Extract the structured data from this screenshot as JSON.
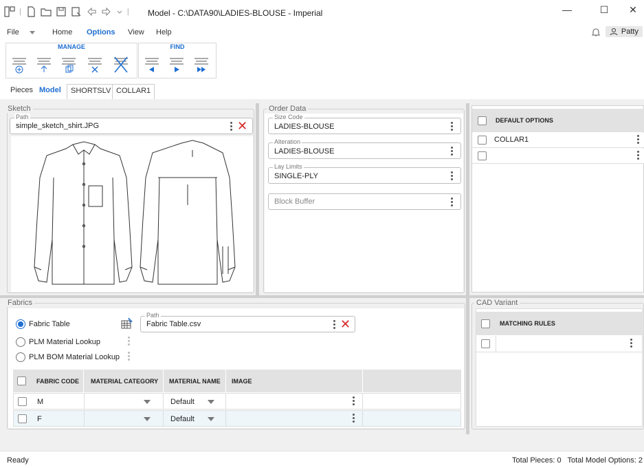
{
  "window": {
    "title": "Model - C:\\DATA90\\LADIES-BLOUSE - Imperial",
    "minimize": "—",
    "maximize": "☐",
    "close": "✕"
  },
  "menu": {
    "file": "File",
    "home": "Home",
    "options": "Options",
    "view": "View",
    "help": "Help",
    "user": "Patty"
  },
  "ribbon": {
    "manage_title": "MANAGE",
    "find_title": "FIND"
  },
  "tabs": [
    "Pieces",
    "Model",
    "SHORTSLV",
    "COLLAR1"
  ],
  "sketch": {
    "group_label": "Sketch",
    "path_label": "Path",
    "path_value": "simple_sketch_shirt.JPG"
  },
  "order_data": {
    "group_label": "Order Data",
    "size_code_label": "Size Code",
    "size_code_value": "LADIES-BLOUSE",
    "alteration_label": "Alteration",
    "alteration_value": "LADIES-BLOUSE",
    "lay_limits_label": "Lay Limits",
    "lay_limits_value": "SINGLE-PLY",
    "block_buffer_placeholder": "Block Buffer"
  },
  "default_options": {
    "header": "DEFAULT OPTIONS",
    "rows": [
      "COLLAR1",
      ""
    ]
  },
  "fabrics": {
    "group_label": "Fabrics",
    "radio_fabric_table": "Fabric Table",
    "radio_plm_lookup": "PLM Material Lookup",
    "radio_plm_bom": "PLM BOM Material Lookup",
    "path_label": "Path",
    "path_value": "Fabric Table.csv",
    "columns": [
      "FABRIC CODE",
      "MATERIAL CATEGORY",
      "MATERIAL NAME",
      "IMAGE"
    ],
    "rows": [
      {
        "code": "M",
        "category": "",
        "name": "Default"
      },
      {
        "code": "F",
        "category": "",
        "name": "Default"
      }
    ]
  },
  "cad_variant": {
    "group_label": "CAD Variant",
    "header": "MATCHING RULES"
  },
  "status": {
    "left": "Ready",
    "right": "Total Pieces: 0   Total Model Options: 2"
  }
}
